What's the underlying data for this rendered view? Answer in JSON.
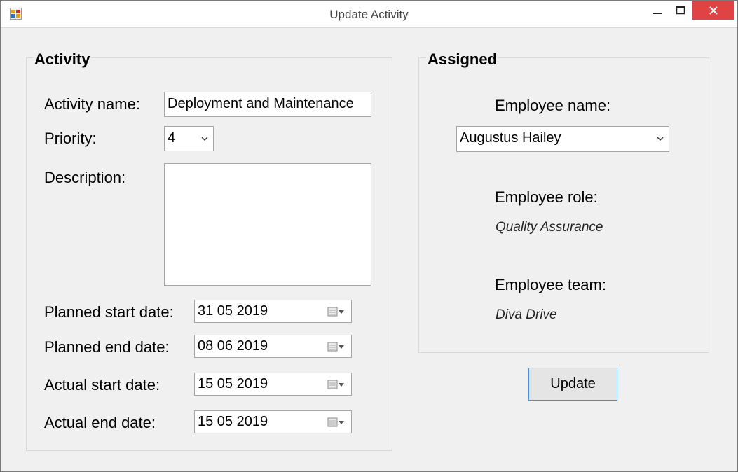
{
  "window": {
    "title": "Update Activity"
  },
  "activity": {
    "group_title": "Activity",
    "name_label": "Activity name:",
    "name_value": "Deployment and Maintenance",
    "priority_label": "Priority:",
    "priority_value": "4",
    "description_label": "Description:",
    "description_value": "",
    "planned_start_label": "Planned start date:",
    "planned_start_value": "31 05 2019",
    "planned_end_label": "Planned end date:",
    "planned_end_value": "08 06 2019",
    "actual_start_label": "Actual start date:",
    "actual_start_value": "15 05 2019",
    "actual_end_label": "Actual end date:",
    "actual_end_value": "15 05 2019"
  },
  "assigned": {
    "group_title": "Assigned",
    "employee_name_label": "Employee name:",
    "employee_name_value": "Augustus Hailey",
    "employee_role_label": "Employee role:",
    "employee_role_value": "Quality Assurance",
    "employee_team_label": "Employee team:",
    "employee_team_value": "Diva Drive"
  },
  "update_button_label": "Update",
  "icons": [
    "app-icon",
    "minimize-icon",
    "maximize-icon",
    "close-icon",
    "chevron-down-icon",
    "calendar-icon"
  ],
  "colors": {
    "close_button": "#e04343",
    "button_focus_border": "#3c92e0"
  }
}
